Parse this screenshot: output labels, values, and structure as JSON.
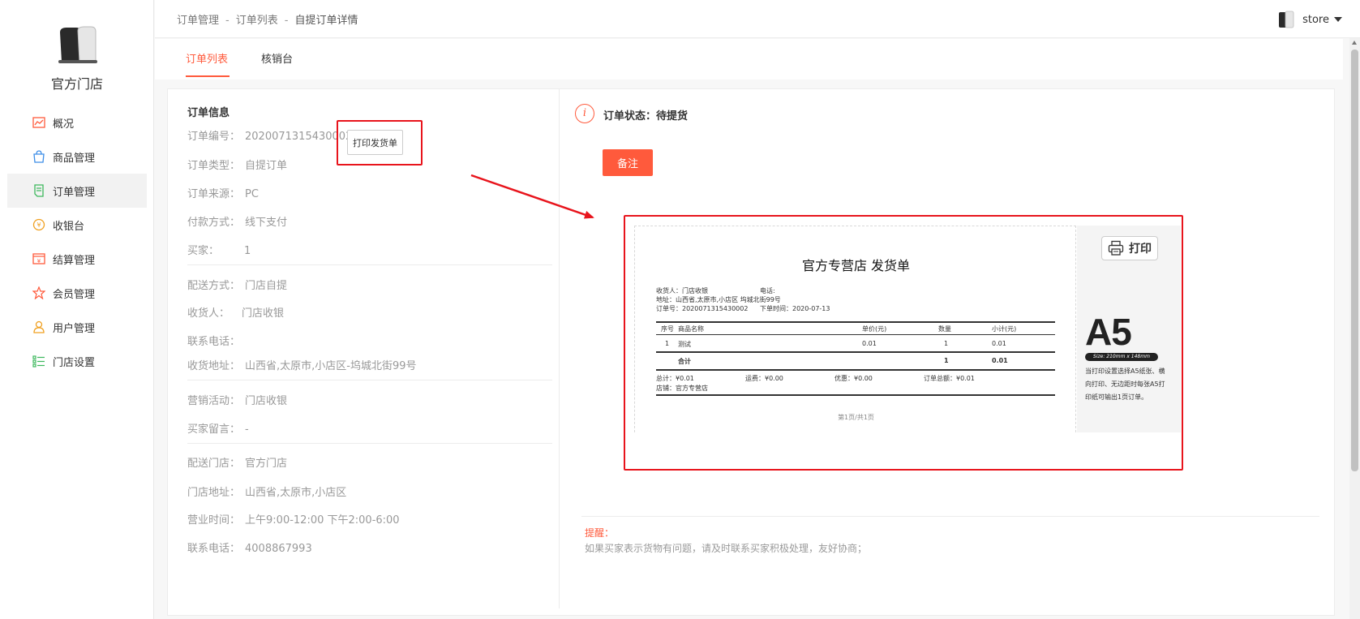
{
  "brand": {
    "shop_name": "官方门店"
  },
  "sidebar": {
    "items": [
      {
        "label": "概况",
        "icon": "chart-icon"
      },
      {
        "label": "商品管理",
        "icon": "shopping-bag-icon"
      },
      {
        "label": "订单管理",
        "icon": "order-icon"
      },
      {
        "label": "收银台",
        "icon": "cashier-icon"
      },
      {
        "label": "结算管理",
        "icon": "settlement-icon"
      },
      {
        "label": "会员管理",
        "icon": "member-icon"
      },
      {
        "label": "用户管理",
        "icon": "user-icon"
      },
      {
        "label": "门店设置",
        "icon": "settings-list-icon"
      }
    ]
  },
  "breadcrumb": [
    "订单管理",
    "订单列表",
    "自提订单详情"
  ],
  "user": {
    "name": "store"
  },
  "tabs": [
    "订单列表",
    "核销台"
  ],
  "order_info": {
    "title": "订单信息",
    "print_button": "打印发货单",
    "rows": [
      {
        "label": "订单编号：",
        "value": "2020071315430002"
      },
      {
        "label": "订单类型：",
        "value": "自提订单"
      },
      {
        "label": "订单来源：",
        "value": "PC"
      },
      {
        "label": "付款方式：",
        "value": "线下支付"
      },
      {
        "label": "买家：",
        "value": "1"
      },
      {
        "label": "配送方式：",
        "value": "门店自提"
      },
      {
        "label": "收货人：",
        "value": "门店收银"
      },
      {
        "label": "联系电话：",
        "value": ""
      },
      {
        "label": "收货地址：",
        "value": "山西省,太原市,小店区-坞城北街99号"
      },
      {
        "label": "营销活动：",
        "value": "门店收银"
      },
      {
        "label": "买家留言：",
        "value": "-"
      },
      {
        "label": "配送门店：",
        "value": "官方门店"
      },
      {
        "label": "门店地址：",
        "value": "山西省,太原市,小店区"
      },
      {
        "label": "营业时间：",
        "value": "上午9:00-12:00 下午2:00-6:00"
      },
      {
        "label": "联系电话：",
        "value": "4008867993"
      }
    ]
  },
  "status": {
    "icon": "info-icon",
    "text": "订单状态：待提货",
    "remark_button": "备注"
  },
  "invoice": {
    "title": "官方专营店 发货单",
    "receiver": "收货人：门店收银",
    "phone": "电话:",
    "address": "地址：山西省,太原市,小店区 坞城北街99号",
    "order_no": "订单号：2020071315430002",
    "order_time": "下单时间：2020-07-13",
    "headers": [
      "序号",
      "商品名称",
      "单价(元)",
      "数量",
      "小计(元)"
    ],
    "rows": [
      [
        "1",
        "测试",
        "0.01",
        "1",
        "0.01"
      ]
    ],
    "total_label": "合计",
    "total_qty": "1",
    "total_amount": "0.01",
    "sum_total": "总计：¥0.01",
    "shipping": "运费：¥0.00",
    "discount": "优惠：¥0.00",
    "order_total": "订单总额：¥0.01",
    "store": "店铺：官方专营店",
    "page": "第1页/共1页",
    "print_label": "打印",
    "paper": "A5",
    "paper_size": "Size: 210mm x 148mm",
    "paper_note": "当打印设置选择A5纸张、横向打印、无边距时每张A5打印纸可输出1页订单。"
  },
  "tip": {
    "title": "提醒：",
    "text": "如果买家表示货物有问题，请及时联系买家积极处理，友好协商；"
  },
  "colors": {
    "accent": "#ff5a3c",
    "highlight": "#e8141c"
  }
}
